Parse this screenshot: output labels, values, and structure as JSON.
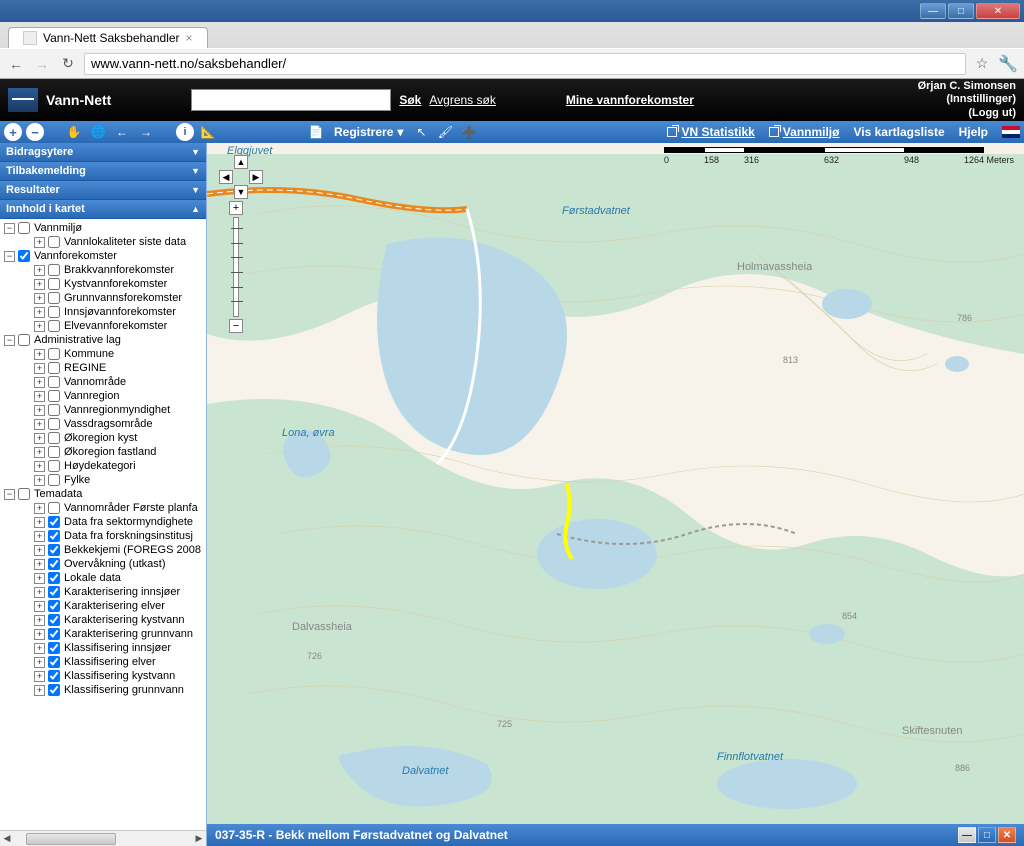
{
  "browser": {
    "tab_title": "Vann-Nett Saksbehandler",
    "url": "www.vann-nett.no/saksbehandler/"
  },
  "header": {
    "app_title": "Vann-Nett",
    "search_label": "Søk",
    "refine_label": "Avgrens søk",
    "mine_label": "Mine vannforekomster",
    "user_name": "Ørjan C. Simonsen",
    "settings": "(Innstillinger)",
    "logout": "(Logg ut)"
  },
  "toolbar": {
    "registrere": "Registrere",
    "vn_statistikk": "VN Statistikk",
    "vannmiljo": "Vannmiljø",
    "vis_kartlagsliste": "Vis kartlagsliste",
    "hjelp": "Hjelp"
  },
  "side_panels": {
    "bidragsytere": "Bidragsytere",
    "tilbakemelding": "Tilbakemelding",
    "resultater": "Resultater",
    "innhold": "Innhold i kartet"
  },
  "tree": {
    "vannmiljo": "Vannmiljø",
    "vannlokaliteter": "Vannlokaliteter siste data",
    "vannforekomster": "Vannforekomster",
    "brakkvann": "Brakkvannforekomster",
    "kystvann": "Kystvannforekomster",
    "grunnvann": "Grunnvannsforekomster",
    "innsjo": "Innsjøvannforekomster",
    "elve": "Elvevannforekomster",
    "adminlag": "Administrative lag",
    "kommune": "Kommune",
    "regine": "REGINE",
    "vannomrade": "Vannområde",
    "vannregion": "Vannregion",
    "vannregionmynd": "Vannregionmyndighet",
    "vassdragsomrade": "Vassdragsområde",
    "okoregion_kyst": "Økoregion kyst",
    "okoregion_fastland": "Økoregion fastland",
    "hoydekategori": "Høydekategori",
    "fylke": "Fylke",
    "temadata": "Temadata",
    "vannomrader_forste": "Vannområder Første planfa",
    "data_sektor": "Data fra sektormyndighete",
    "data_forskning": "Data fra forskningsinstitusj",
    "bekkekjemi": "Bekkekjemi (FOREGS 2008",
    "overvakning": "Overvåkning (utkast)",
    "lokale_data": "Lokale data",
    "karakt_innsjoer": "Karakterisering innsjøer",
    "karakt_elver": "Karakterisering elver",
    "karakt_kystvann": "Karakterisering kystvann",
    "karakt_grunnvann": "Karakterisering grunnvann",
    "klass_innsjoer": "Klassifisering innsjøer",
    "klass_elver": "Klassifisering elver",
    "klass_kystvann": "Klassifisering kystvann",
    "klass_grunnvann": "Klassifisering grunnvann"
  },
  "map": {
    "scale_labels": [
      "0",
      "158",
      "316",
      "632",
      "948",
      "1264"
    ],
    "scale_unit": "Meters",
    "labels": {
      "elggjuvet": "Elggjuvet",
      "forstadvatnet": "Førstadvatnet",
      "holmavassheia": "Holmavassheia",
      "lona_ovra": "Lona, øvra",
      "dalvassheia": "Dalvassheia",
      "dalvatnet": "Dalvatnet",
      "finnflotvatnet": "Finnflotvatnet",
      "skiftesnuten": "Skiftesnuten",
      "h786": "786",
      "h813": "813",
      "h854": "854",
      "h726": "726",
      "h725": "725",
      "h886": "886"
    }
  },
  "status": {
    "text": "037-35-R - Bekk mellom Førstadvatnet og Dalvatnet"
  }
}
